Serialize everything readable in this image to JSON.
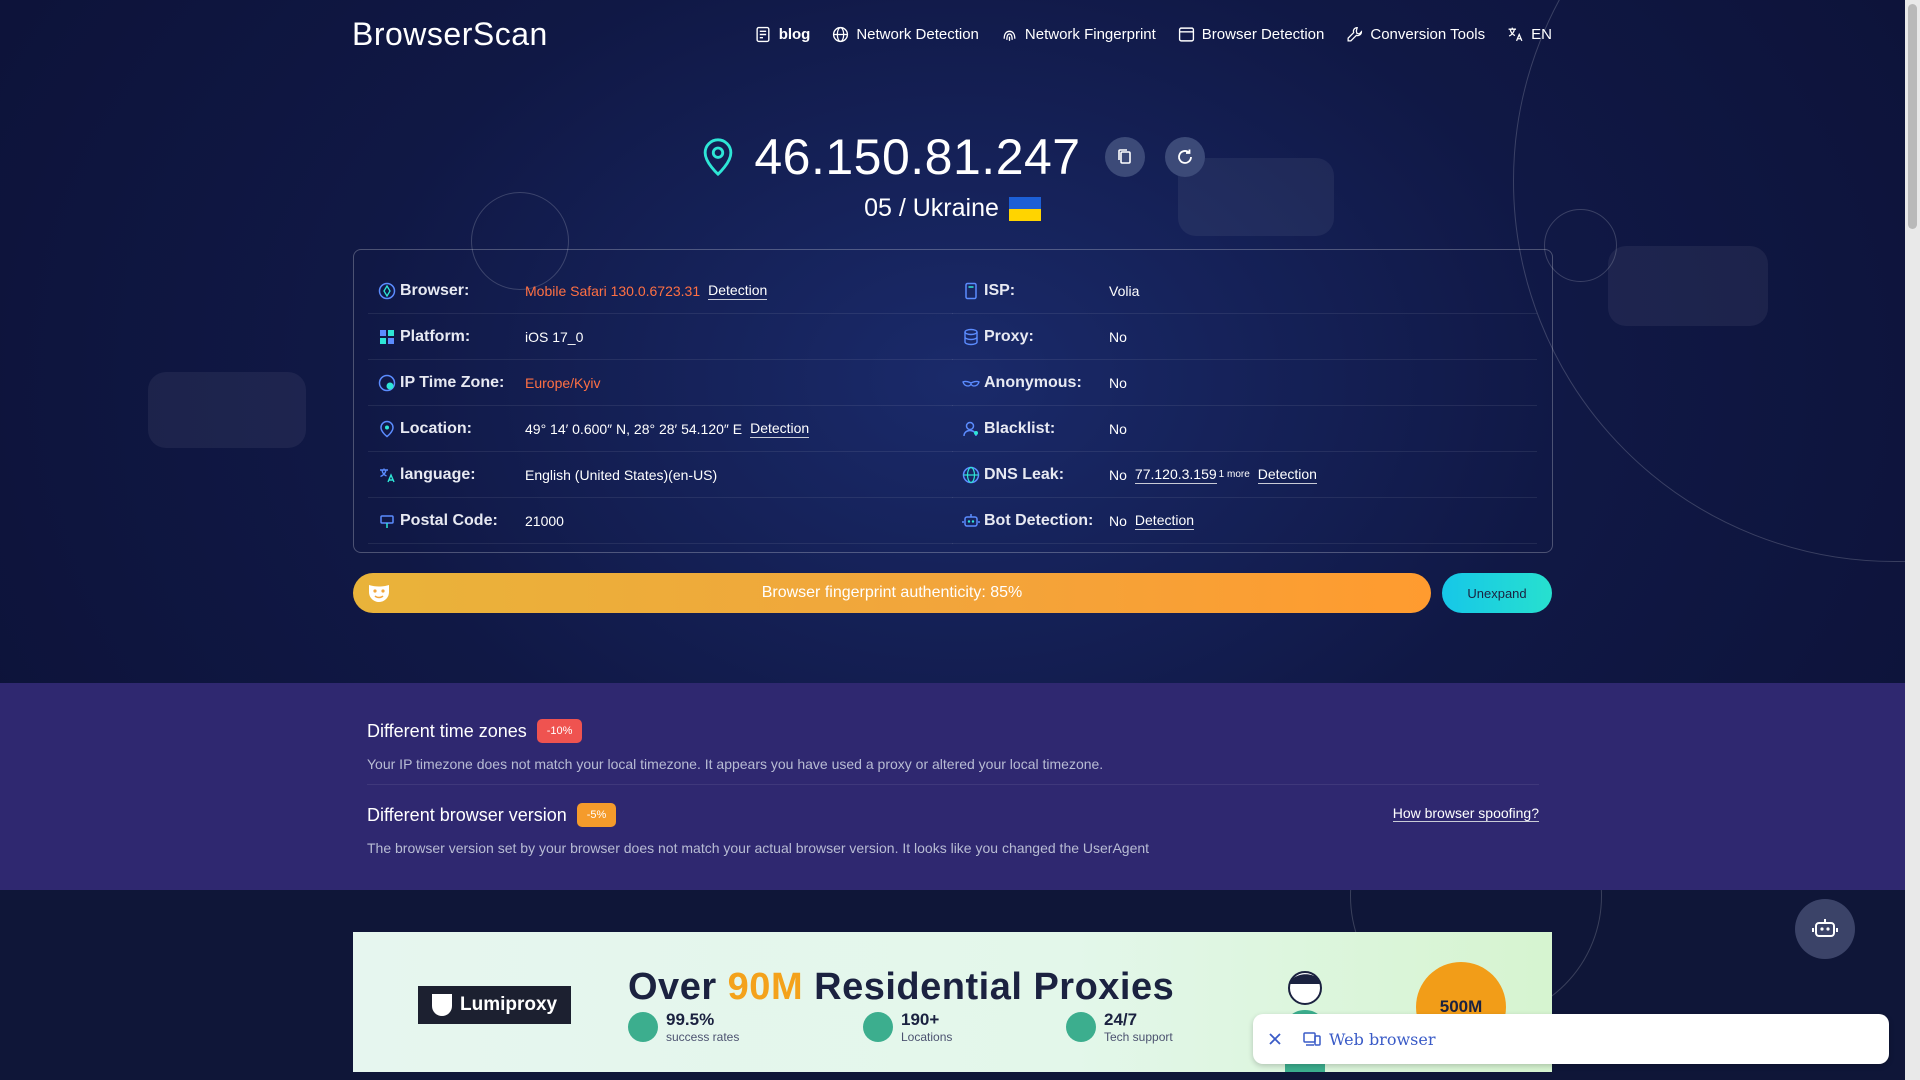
{
  "header": {
    "logo": "BrowserScan",
    "nav": [
      {
        "label": "blog",
        "icon": "blog-icon"
      },
      {
        "label": "Network Detection",
        "icon": "globe-icon"
      },
      {
        "label": "Network Fingerprint",
        "icon": "fingerprint-icon"
      },
      {
        "label": "Browser Detection",
        "icon": "browser-window-icon"
      },
      {
        "label": "Conversion Tools",
        "icon": "wrench-icon"
      },
      {
        "label": "EN",
        "icon": "translate-icon"
      }
    ]
  },
  "ip": {
    "address": "46.150.81.247",
    "location": "05 / Ukraine"
  },
  "info_left": [
    {
      "label": "Browser:",
      "value": "Mobile Safari 130.0.6723.31",
      "link": "Detection",
      "icon": "browser-icon"
    },
    {
      "label": "Platform:",
      "value": "iOS 17_0",
      "icon": "platform-icon"
    },
    {
      "label": "IP Time Zone:",
      "value": "Europe/Kyiv",
      "icon": "timezone-icon"
    },
    {
      "label": "Location:",
      "value": "49° 14′ 0.600″ N, 28° 28′ 54.120″ E",
      "link": "Detection",
      "icon": "location-pin-icon"
    },
    {
      "label": "language:",
      "value": "English (United States)(en-US)",
      "icon": "language-icon"
    },
    {
      "label": "Postal Code:",
      "value": "21000",
      "icon": "postal-icon"
    }
  ],
  "info_right": [
    {
      "label": "ISP:",
      "value": "Volia",
      "icon": "isp-icon"
    },
    {
      "label": "Proxy:",
      "value": "No",
      "icon": "database-icon"
    },
    {
      "label": "Anonymous:",
      "value": "No",
      "icon": "anonymous-icon"
    },
    {
      "label": "Blacklist:",
      "value": "No",
      "icon": "user-icon"
    },
    {
      "label": "DNS Leak:",
      "value": "No",
      "dns": "77.120.3.159",
      "more": "1 more",
      "link": "Detection",
      "icon": "dns-globe-icon"
    },
    {
      "label": "Bot Detection:",
      "value": "No",
      "link": "Detection",
      "icon": "bot-icon"
    }
  ],
  "fingerprint": {
    "text": "Browser fingerprint authenticity: 85%",
    "button": "Unexpand"
  },
  "warnings": [
    {
      "title": "Different time zones",
      "badge": "-10%",
      "desc": "Your IP timezone does not match your local timezone. It appears you have used a proxy or altered your local timezone."
    },
    {
      "title": "Different browser version",
      "badge": "-5%",
      "desc": "The browser version set by your browser does not match your actual browser version. It looks like you changed the UserAgent",
      "link": "How browser spoofing?"
    }
  ],
  "ad": {
    "brand": "Lumiproxy",
    "title_pre": "Over ",
    "title_hl": "90M",
    "title_post": " Residential Proxies",
    "stats": [
      {
        "num": "99.5%",
        "cap": "success rates"
      },
      {
        "num": "190+",
        "cap": "Locations"
      },
      {
        "num": "24/7",
        "cap": "Tech support"
      }
    ],
    "badge": "500M"
  },
  "web_pill": {
    "label": "Web browser"
  },
  "colors": {
    "accent_orange": "#ff7043",
    "fp_bar": "#f2a53b",
    "unexpand": "#16c7e8",
    "warn_bg": "#2f2870"
  }
}
